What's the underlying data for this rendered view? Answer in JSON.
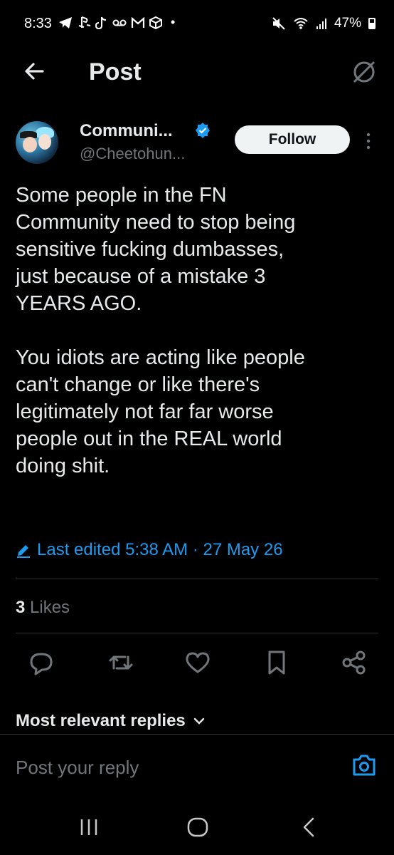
{
  "status_bar": {
    "time": "8:33",
    "battery": "47%"
  },
  "header": {
    "title": "Post"
  },
  "author": {
    "name": "Communi...",
    "handle": "@Cheetohun..."
  },
  "follow_label": "Follow",
  "post": {
    "text": "Some people in the FN\nCommunity need to stop being\nsensitive fucking dumbasses,\njust because of a mistake 3\nYEARS AGO.\n\nYou idiots are acting like people\ncan't change or like there's\nlegitimately not far far worse\npeople out in the REAL world\ndoing shit.",
    "edited": "Last edited 5:38 AM · 27 May 26"
  },
  "likes": {
    "count": "3",
    "label": "Likes"
  },
  "replies_filter": "Most relevant replies",
  "reply_placeholder": "Post your reply",
  "colors": {
    "accent": "#1d9bf0",
    "background": "#000000",
    "text": "#e7e9ea",
    "muted": "#71767b"
  }
}
